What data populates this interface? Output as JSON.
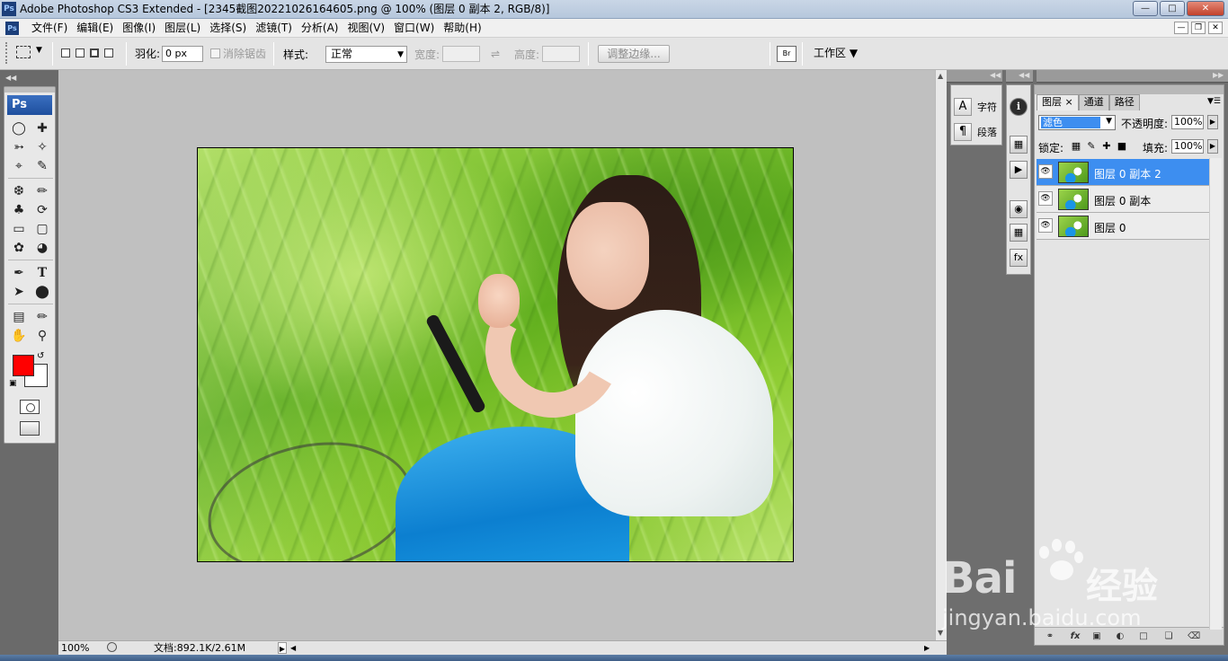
{
  "window": {
    "logo": "Ps",
    "title": "Adobe Photoshop CS3 Extended - [2345截图20221026164605.png @ 100% (图层 0 副本 2, RGB/8)]",
    "buttons": [
      "minimize",
      "maximize",
      "close"
    ]
  },
  "menubar": {
    "items": [
      "文件(F)",
      "编辑(E)",
      "图像(I)",
      "图层(L)",
      "选择(S)",
      "滤镜(T)",
      "分析(A)",
      "视图(V)",
      "窗口(W)",
      "帮助(H)"
    ]
  },
  "options": {
    "feather_label": "羽化:",
    "feather_value": "0 px",
    "antialias_label": "消除锯齿",
    "style_label": "样式:",
    "style_value": "正常",
    "width_label": "宽度:",
    "height_label": "高度:",
    "refine_edge": "调整边缘...",
    "workspace": "工作区"
  },
  "toolbox": {
    "logo": "Ps",
    "foreground_color": "#ff0000",
    "background_color": "#ffffff"
  },
  "character_panel": {
    "char_label": "字符",
    "para_label": "段落"
  },
  "layers_panel": {
    "tabs": [
      "图层",
      "通道",
      "路径"
    ],
    "blend_mode": "滤色",
    "opacity_label": "不透明度:",
    "opacity_value": "100%",
    "lock_label": "锁定:",
    "fill_label": "填充:",
    "fill_value": "100%",
    "layers": [
      {
        "name": "图层 0 副本 2",
        "selected": true
      },
      {
        "name": "图层 0 副本",
        "selected": false
      },
      {
        "name": "图层 0",
        "selected": false
      }
    ]
  },
  "status": {
    "zoom": "100%",
    "doc_info": "文档:892.1K/2.61M"
  },
  "watermark": {
    "brand": "Bai",
    "cn": "经验",
    "url": "jingyan.baidu.com"
  }
}
